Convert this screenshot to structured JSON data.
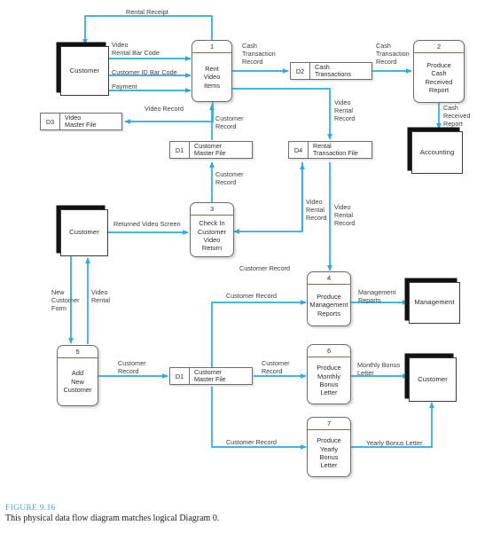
{
  "figure": {
    "number": "FIGURE 9.16",
    "caption": "This physical data flow diagram matches logical Diagram 0.",
    "accent_color": "#4aa8dd",
    "flow_color": "#29ace3"
  },
  "entities": [
    {
      "id": "customer-top",
      "label": "Customer"
    },
    {
      "id": "accounting",
      "label": "Accounting"
    },
    {
      "id": "customer-middle",
      "label": "Customer"
    },
    {
      "id": "management",
      "label": "Management"
    },
    {
      "id": "customer-bottom",
      "label": "Customer"
    }
  ],
  "processes": [
    {
      "id": "p1",
      "number": "1",
      "name": "Rent\nVideo\nItems"
    },
    {
      "id": "p2",
      "number": "2",
      "name": "Produce\nCash\nReceived\nReport"
    },
    {
      "id": "p3",
      "number": "3",
      "name": "Check In\nCustomer\nVideo\nReturn"
    },
    {
      "id": "p4",
      "number": "4",
      "name": "Produce\nManagement\nReports"
    },
    {
      "id": "p5",
      "number": "5",
      "name": "Add\nNew\nCustomer"
    },
    {
      "id": "p6",
      "number": "6",
      "name": "Produce\nMonthly\nBonus\nLetter"
    },
    {
      "id": "p7",
      "number": "7",
      "name": "Produce\nYearly\nBonus\nLetter"
    }
  ],
  "stores": [
    {
      "id": "d3",
      "code": "D3",
      "name": "Video\nMaster File"
    },
    {
      "id": "d2",
      "code": "D2",
      "name": "Cash\nTransactions"
    },
    {
      "id": "d1-top",
      "code": "D1",
      "name": "Customer\nMaster File"
    },
    {
      "id": "d4",
      "code": "D4",
      "name": "Rental\nTransaction File"
    },
    {
      "id": "d1-bot",
      "code": "D1",
      "name": "Customer\nMaster File"
    }
  ],
  "flows": [
    {
      "id": "f-rental-receipt",
      "label": "Rental Receipt"
    },
    {
      "id": "f-video-rental-barcode",
      "label": "Video\nRental Bar Code"
    },
    {
      "id": "f-customer-id-barcode",
      "label": "Customer ID Bar Code"
    },
    {
      "id": "f-payment",
      "label": "Payment"
    },
    {
      "id": "f-cash-trans-rec-1",
      "label": "Cash\nTransaction\nRecord"
    },
    {
      "id": "f-cash-trans-rec-2",
      "label": "Cash\nTransaction\nRecord"
    },
    {
      "id": "f-video-record",
      "label": "Video Record"
    },
    {
      "id": "f-customer-record-1",
      "label": "Customer\nRecord"
    },
    {
      "id": "f-video-rental-record-1",
      "label": "Video\nRental\nRecord"
    },
    {
      "id": "f-cash-received-report",
      "label": "Cash\nReceived\nReport"
    },
    {
      "id": "f-customer-record-2",
      "label": "Customer\nRecord"
    },
    {
      "id": "f-returned-video-screen",
      "label": "Returned Video Screen"
    },
    {
      "id": "f-video-rental-record-2",
      "label": "Video\nRental\nRecord"
    },
    {
      "id": "f-video-rental-record-3",
      "label": "Video\nRental\nRecord"
    },
    {
      "id": "f-customer-record-3",
      "label": "Customer Record"
    },
    {
      "id": "f-customer-record-4",
      "label": "Customer Record"
    },
    {
      "id": "f-management-reports",
      "label": "Management\nReports"
    },
    {
      "id": "f-new-customer-form",
      "label": "New\nCustomer\nForm"
    },
    {
      "id": "f-video-rental",
      "label": "Video\nRental"
    },
    {
      "id": "f-customer-record-5",
      "label": "Customer\nRecord"
    },
    {
      "id": "f-customer-record-6",
      "label": "Customer\nRecord"
    },
    {
      "id": "f-monthly-bonus-letter",
      "label": "Monthly Bonus\nLetter"
    },
    {
      "id": "f-customer-record-7",
      "label": "Customer Record"
    },
    {
      "id": "f-yearly-bonus-letter",
      "label": "Yearly Bonus Letter"
    }
  ]
}
